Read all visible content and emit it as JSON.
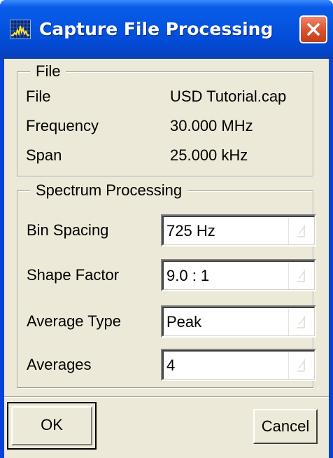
{
  "window": {
    "title": "Capture File Processing",
    "app_icon": "spectrum-analyzer-icon",
    "close_icon": "close-icon"
  },
  "file_group": {
    "title": "File",
    "rows": [
      {
        "label": "File",
        "value": "USD Tutorial.cap"
      },
      {
        "label": "Frequency",
        "value": "30.000 MHz"
      },
      {
        "label": "Span",
        "value": "25.000 kHz"
      }
    ]
  },
  "spectrum_group": {
    "title": "Spectrum Processing",
    "fields": [
      {
        "label": "Bin Spacing",
        "value": "725 Hz"
      },
      {
        "label": "Shape Factor",
        "value": "9.0 : 1"
      },
      {
        "label": "Average Type",
        "value": "Peak"
      },
      {
        "label": "Averages",
        "value": "4"
      }
    ],
    "dropdown_icon": "dropdown-arrow-icon"
  },
  "buttons": {
    "ok_label": "OK",
    "cancel_label": "Cancel"
  },
  "colors": {
    "titlebar": "#0454e0",
    "close_button": "#d9512d",
    "dialog_background": "#ece9d8"
  }
}
